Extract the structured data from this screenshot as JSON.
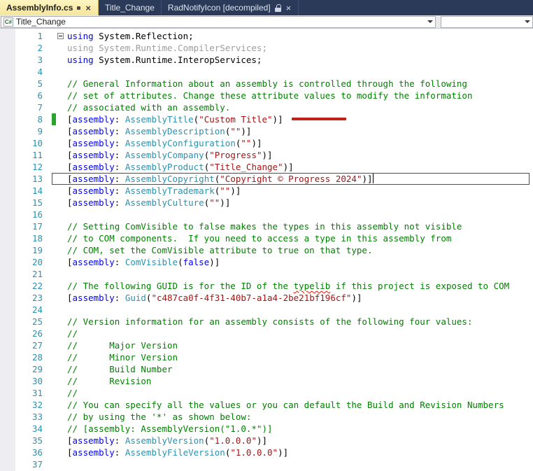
{
  "colors": {
    "tabbar_background": "#2b3a58",
    "active_tab_background": "#f9edab",
    "keyword": "#0000ff",
    "type": "#2b91af",
    "string": "#a31515",
    "comment": "#008000",
    "inactive_code": "#9d9d9d",
    "line_number": "#2b91af",
    "change_bar_green": "#2ca32c",
    "annotation_red": "#bf231a"
  },
  "tabs": {
    "close_glyph": "×",
    "items": [
      {
        "label": "AssemblyInfo.cs",
        "active": true,
        "modified": true,
        "locked": false,
        "closable": true
      },
      {
        "label": "Title_Change",
        "active": false,
        "modified": false,
        "locked": false,
        "closable": false
      },
      {
        "label": "RadNotifyIcon [decompiled]",
        "active": false,
        "modified": false,
        "locked": true,
        "closable": true
      }
    ]
  },
  "navbar": {
    "scope_dropdown": {
      "value": "Title_Change",
      "icon": "csharp-file"
    },
    "member_dropdown": {
      "value": ""
    }
  },
  "editor": {
    "lines": [
      {
        "n": 1,
        "fold": true,
        "tokens": [
          [
            "k",
            "using"
          ],
          [
            "p",
            " System.Reflection;"
          ]
        ]
      },
      {
        "n": 2,
        "tokens": [
          [
            "g",
            "using System.Runtime.CompilerServices;"
          ]
        ]
      },
      {
        "n": 3,
        "tokens": [
          [
            "k",
            "using"
          ],
          [
            "p",
            " System.Runtime.InteropServices;"
          ]
        ]
      },
      {
        "n": 4,
        "tokens": []
      },
      {
        "n": 5,
        "tokens": [
          [
            "c",
            "// General Information about an assembly is controlled through the following"
          ]
        ]
      },
      {
        "n": 6,
        "tokens": [
          [
            "c",
            "// set of attributes. Change these attribute values to modify the information"
          ]
        ]
      },
      {
        "n": 7,
        "tokens": [
          [
            "c",
            "// associated with an assembly."
          ]
        ]
      },
      {
        "n": 8,
        "change": true,
        "redline": true,
        "tokens": [
          [
            "p",
            "["
          ],
          [
            "k",
            "assembly"
          ],
          [
            "p",
            ": "
          ],
          [
            "t",
            "AssemblyTitle"
          ],
          [
            "p",
            "("
          ],
          [
            "s",
            "\"Custom Title\""
          ],
          [
            "p",
            ")]"
          ]
        ]
      },
      {
        "n": 9,
        "tokens": [
          [
            "p",
            "["
          ],
          [
            "k",
            "assembly"
          ],
          [
            "p",
            ": "
          ],
          [
            "t",
            "AssemblyDescription"
          ],
          [
            "p",
            "("
          ],
          [
            "s",
            "\"\""
          ],
          [
            "p",
            ")]"
          ]
        ]
      },
      {
        "n": 10,
        "tokens": [
          [
            "p",
            "["
          ],
          [
            "k",
            "assembly"
          ],
          [
            "p",
            ": "
          ],
          [
            "t",
            "AssemblyConfiguration"
          ],
          [
            "p",
            "("
          ],
          [
            "s",
            "\"\""
          ],
          [
            "p",
            ")]"
          ]
        ]
      },
      {
        "n": 11,
        "tokens": [
          [
            "p",
            "["
          ],
          [
            "k",
            "assembly"
          ],
          [
            "p",
            ": "
          ],
          [
            "t",
            "AssemblyCompany"
          ],
          [
            "p",
            "("
          ],
          [
            "s",
            "\"Progress\""
          ],
          [
            "p",
            ")]"
          ]
        ]
      },
      {
        "n": 12,
        "tokens": [
          [
            "p",
            "["
          ],
          [
            "k",
            "assembly"
          ],
          [
            "p",
            ": "
          ],
          [
            "t",
            "AssemblyProduct"
          ],
          [
            "p",
            "("
          ],
          [
            "s",
            "\"Title_Change\""
          ],
          [
            "p",
            ")]"
          ]
        ]
      },
      {
        "n": 13,
        "current": true,
        "caret": true,
        "tokens": [
          [
            "p",
            "["
          ],
          [
            "k",
            "assembly"
          ],
          [
            "p",
            ": "
          ],
          [
            "t",
            "AssemblyCopyright"
          ],
          [
            "p",
            "("
          ],
          [
            "s",
            "\"Copyright © Progress 2024\""
          ],
          [
            "p",
            ")]"
          ]
        ]
      },
      {
        "n": 14,
        "tokens": [
          [
            "p",
            "["
          ],
          [
            "k",
            "assembly"
          ],
          [
            "p",
            ": "
          ],
          [
            "t",
            "AssemblyTrademark"
          ],
          [
            "p",
            "("
          ],
          [
            "s",
            "\"\""
          ],
          [
            "p",
            ")]"
          ]
        ]
      },
      {
        "n": 15,
        "tokens": [
          [
            "p",
            "["
          ],
          [
            "k",
            "assembly"
          ],
          [
            "p",
            ": "
          ],
          [
            "t",
            "AssemblyCulture"
          ],
          [
            "p",
            "("
          ],
          [
            "s",
            "\"\""
          ],
          [
            "p",
            ")]"
          ]
        ]
      },
      {
        "n": 16,
        "tokens": []
      },
      {
        "n": 17,
        "tokens": [
          [
            "c",
            "// Setting ComVisible to false makes the types in this assembly not visible"
          ]
        ]
      },
      {
        "n": 18,
        "tokens": [
          [
            "c",
            "// to COM components.  If you need to access a type in this assembly from"
          ]
        ]
      },
      {
        "n": 19,
        "tokens": [
          [
            "c",
            "// COM, set the ComVisible attribute to true on that type."
          ]
        ]
      },
      {
        "n": 20,
        "tokens": [
          [
            "p",
            "["
          ],
          [
            "k",
            "assembly"
          ],
          [
            "p",
            ": "
          ],
          [
            "t",
            "ComVisible"
          ],
          [
            "p",
            "("
          ],
          [
            "k",
            "false"
          ],
          [
            "p",
            ")]"
          ]
        ]
      },
      {
        "n": 21,
        "tokens": []
      },
      {
        "n": 22,
        "tokens": [
          [
            "c",
            "// The following GUID is for the ID of the "
          ],
          [
            "cq",
            "typelib"
          ],
          [
            "c",
            " if this project is exposed to COM"
          ]
        ]
      },
      {
        "n": 23,
        "tokens": [
          [
            "p",
            "["
          ],
          [
            "k",
            "assembly"
          ],
          [
            "p",
            ": "
          ],
          [
            "t",
            "Guid"
          ],
          [
            "p",
            "("
          ],
          [
            "s",
            "\"c487ca0f-4f31-40b7-a1a4-2be21bf196cf\""
          ],
          [
            "p",
            ")]"
          ]
        ]
      },
      {
        "n": 24,
        "tokens": []
      },
      {
        "n": 25,
        "tokens": [
          [
            "c",
            "// Version information for an assembly consists of the following four values:"
          ]
        ]
      },
      {
        "n": 26,
        "tokens": [
          [
            "c",
            "//"
          ]
        ]
      },
      {
        "n": 27,
        "tokens": [
          [
            "c",
            "//      Major Version"
          ]
        ]
      },
      {
        "n": 28,
        "tokens": [
          [
            "c",
            "//      Minor Version"
          ]
        ]
      },
      {
        "n": 29,
        "tokens": [
          [
            "c",
            "//      Build Number"
          ]
        ]
      },
      {
        "n": 30,
        "tokens": [
          [
            "c",
            "//      Revision"
          ]
        ]
      },
      {
        "n": 31,
        "tokens": [
          [
            "c",
            "//"
          ]
        ]
      },
      {
        "n": 32,
        "tokens": [
          [
            "c",
            "// You can specify all the values or you can default the Build and Revision Numbers"
          ]
        ]
      },
      {
        "n": 33,
        "tokens": [
          [
            "c",
            "// by using the '*' as shown below:"
          ]
        ]
      },
      {
        "n": 34,
        "tokens": [
          [
            "c",
            "// [assembly: AssemblyVersion(\"1.0.*\")]"
          ]
        ]
      },
      {
        "n": 35,
        "tokens": [
          [
            "p",
            "["
          ],
          [
            "k",
            "assembly"
          ],
          [
            "p",
            ": "
          ],
          [
            "t",
            "AssemblyVersion"
          ],
          [
            "p",
            "("
          ],
          [
            "s",
            "\"1.0.0.0\""
          ],
          [
            "p",
            ")]"
          ]
        ]
      },
      {
        "n": 36,
        "tokens": [
          [
            "p",
            "["
          ],
          [
            "k",
            "assembly"
          ],
          [
            "p",
            ": "
          ],
          [
            "t",
            "AssemblyFileVersion"
          ],
          [
            "p",
            "("
          ],
          [
            "s",
            "\"1.0.0.0\""
          ],
          [
            "p",
            ")]"
          ]
        ]
      },
      {
        "n": 37,
        "tokens": []
      }
    ]
  }
}
